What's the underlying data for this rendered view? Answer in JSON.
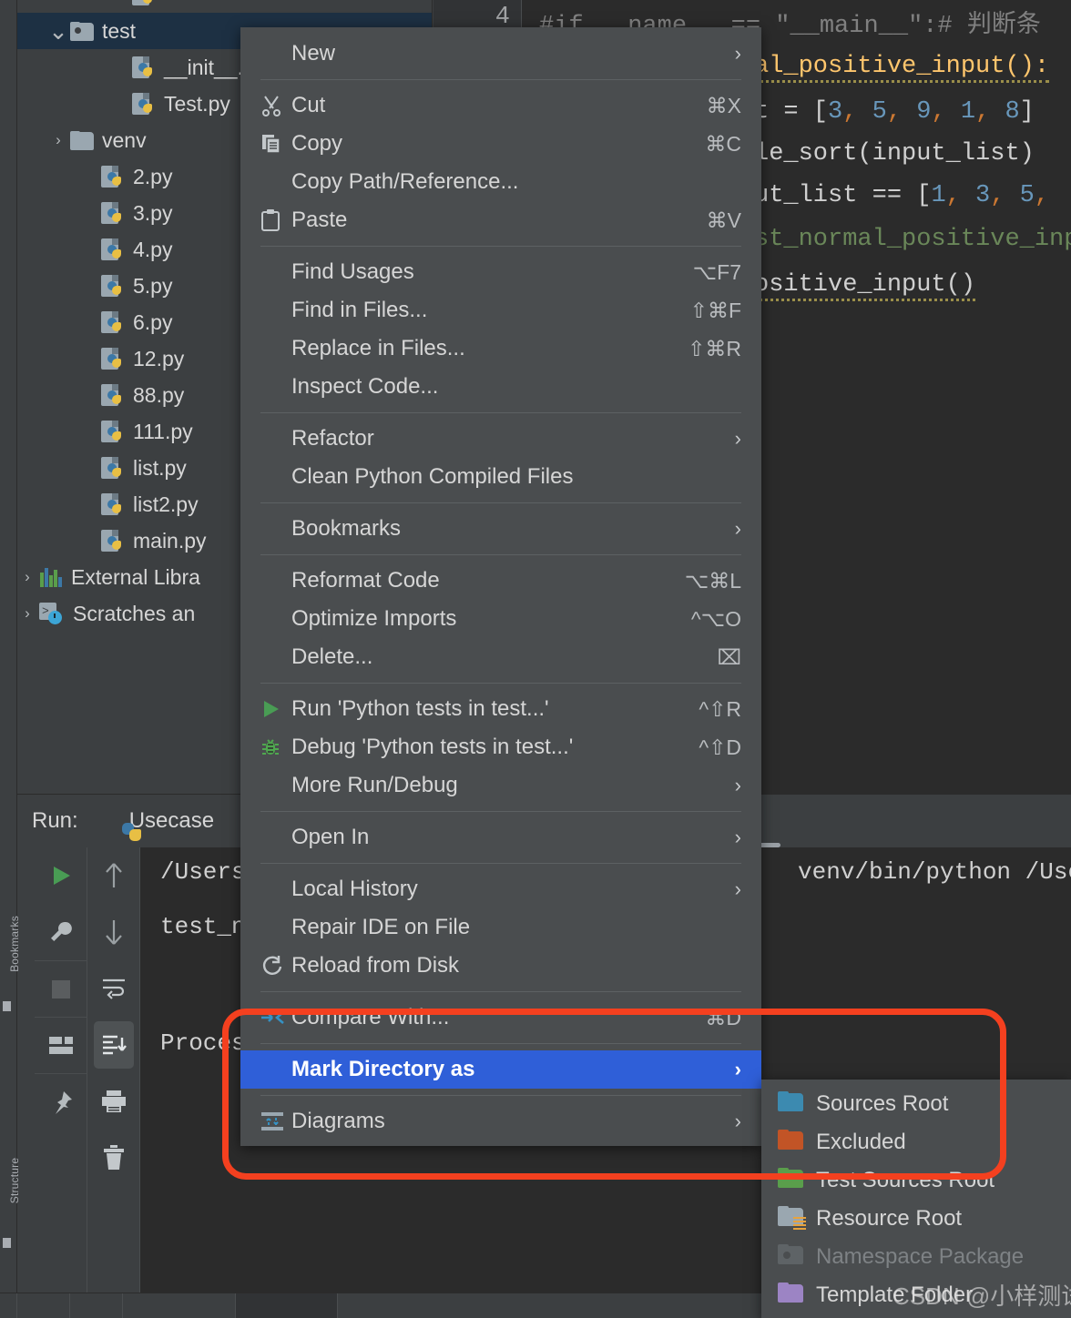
{
  "project_tree": {
    "rows": [
      {
        "label": "",
        "indent": 3,
        "icon": "python-file-icon",
        "partial": true,
        "arrow": "none",
        "selected": false
      },
      {
        "label": "test",
        "indent": 1,
        "icon": "package-folder-icon",
        "arrow": "down",
        "selected": true
      },
      {
        "label": "__init__.py",
        "indent": 3,
        "icon": "python-file-icon",
        "arrow": "none",
        "selected": false
      },
      {
        "label": "Test.py",
        "indent": 3,
        "icon": "python-file-icon",
        "arrow": "none",
        "selected": false
      },
      {
        "label": "venv",
        "indent": 1,
        "icon": "folder-icon",
        "arrow": "right",
        "selected": false
      },
      {
        "label": "2.py",
        "indent": 2,
        "icon": "python-file-icon",
        "arrow": "none",
        "selected": false
      },
      {
        "label": "3.py",
        "indent": 2,
        "icon": "python-file-icon",
        "arrow": "none",
        "selected": false
      },
      {
        "label": "4.py",
        "indent": 2,
        "icon": "python-file-icon",
        "arrow": "none",
        "selected": false
      },
      {
        "label": "5.py",
        "indent": 2,
        "icon": "python-file-icon",
        "arrow": "none",
        "selected": false
      },
      {
        "label": "6.py",
        "indent": 2,
        "icon": "python-file-icon",
        "arrow": "none",
        "selected": false
      },
      {
        "label": "12.py",
        "indent": 2,
        "icon": "python-file-icon",
        "arrow": "none",
        "selected": false
      },
      {
        "label": "88.py",
        "indent": 2,
        "icon": "python-file-icon",
        "arrow": "none",
        "selected": false
      },
      {
        "label": "111.py",
        "indent": 2,
        "icon": "python-file-icon",
        "arrow": "none",
        "selected": false
      },
      {
        "label": "list.py",
        "indent": 2,
        "icon": "python-file-icon",
        "arrow": "none",
        "selected": false
      },
      {
        "label": "list2.py",
        "indent": 2,
        "icon": "python-file-icon",
        "arrow": "none",
        "selected": false
      },
      {
        "label": "main.py",
        "indent": 2,
        "icon": "python-file-icon",
        "arrow": "none",
        "selected": false
      },
      {
        "label": "External Libra",
        "indent": 0,
        "icon": "external-libraries-icon",
        "arrow": "right",
        "selected": false
      },
      {
        "label": "Scratches an",
        "indent": 0,
        "icon": "scratches-icon",
        "arrow": "right",
        "selected": false
      }
    ]
  },
  "tool_window_tabs": {
    "bookmarks": "Bookmarks",
    "structure": "Structure"
  },
  "editor": {
    "gutter_line_number": "4",
    "lines": [
      "#if __name__ == \"__main__\":# 判断条",
      "al_positive_input():",
      "t = [3, 5, 9, 1, 8]",
      "le_sort(input_list)",
      "ut_list == [1, 3, 5,",
      "st_normal_positive_inp",
      "ositive_input()"
    ]
  },
  "run_panel": {
    "label": "Run:",
    "tab_name": "Usecase",
    "tab_icon": "python-icon",
    "console_lines": [
      "/Users/",
      "venv/bin/python /Users",
      "test_n",
      "Process"
    ],
    "toolbar_left": [
      {
        "name": "rerun-button",
        "icon": "play-icon"
      },
      {
        "name": "edit-configurations-button",
        "icon": "wrench-icon"
      },
      {
        "name": "stop-button",
        "icon": "stop-square-icon"
      },
      {
        "name": "layout-button",
        "icon": "layout-icon"
      },
      {
        "name": "pin-tab-button",
        "icon": "pin-icon"
      }
    ],
    "toolbar_right": [
      {
        "name": "up-button",
        "icon": "arrow-up-icon"
      },
      {
        "name": "down-button",
        "icon": "arrow-down-icon"
      },
      {
        "name": "soft-wrap-button",
        "icon": "wrap-icon"
      },
      {
        "name": "scroll-to-end-button",
        "icon": "scroll-end-icon",
        "active": true
      },
      {
        "name": "print-button",
        "icon": "printer-icon"
      },
      {
        "name": "clear-all-button",
        "icon": "trash-icon"
      }
    ]
  },
  "context_menu": {
    "items": [
      {
        "label": "New",
        "shortcut": "",
        "icon": "",
        "submenu": true,
        "sep_after": true
      },
      {
        "label": "Cut",
        "shortcut": "⌘X",
        "icon": "scissors-icon",
        "submenu": false
      },
      {
        "label": "Copy",
        "shortcut": "⌘C",
        "icon": "copy-icon",
        "submenu": false
      },
      {
        "label": "Copy Path/Reference...",
        "shortcut": "",
        "icon": "",
        "submenu": false
      },
      {
        "label": "Paste",
        "shortcut": "⌘V",
        "icon": "clipboard-icon",
        "submenu": false,
        "sep_after": true
      },
      {
        "label": "Find Usages",
        "shortcut": "⌥F7",
        "icon": "",
        "submenu": false
      },
      {
        "label": "Find in Files...",
        "shortcut": "⇧⌘F",
        "icon": "",
        "submenu": false
      },
      {
        "label": "Replace in Files...",
        "shortcut": "⇧⌘R",
        "icon": "",
        "submenu": false
      },
      {
        "label": "Inspect Code...",
        "shortcut": "",
        "icon": "",
        "submenu": false,
        "sep_after": true
      },
      {
        "label": "Refactor",
        "shortcut": "",
        "icon": "",
        "submenu": true
      },
      {
        "label": "Clean Python Compiled Files",
        "shortcut": "",
        "icon": "",
        "submenu": false,
        "sep_after": true
      },
      {
        "label": "Bookmarks",
        "shortcut": "",
        "icon": "",
        "submenu": true,
        "sep_after": true
      },
      {
        "label": "Reformat Code",
        "shortcut": "⌥⌘L",
        "icon": "",
        "submenu": false
      },
      {
        "label": "Optimize Imports",
        "shortcut": "^⌥O",
        "icon": "",
        "submenu": false
      },
      {
        "label": "Delete...",
        "shortcut": "⌧",
        "icon": "",
        "submenu": false,
        "sep_after": true
      },
      {
        "label": "Run 'Python tests in test...'",
        "shortcut": "^⇧R",
        "icon": "run-play-icon",
        "submenu": false
      },
      {
        "label": "Debug 'Python tests in test...'",
        "shortcut": "^⇧D",
        "icon": "debug-bug-icon",
        "submenu": false
      },
      {
        "label": "More Run/Debug",
        "shortcut": "",
        "icon": "",
        "submenu": true,
        "sep_after": true
      },
      {
        "label": "Open In",
        "shortcut": "",
        "icon": "",
        "submenu": true,
        "sep_after": true
      },
      {
        "label": "Local History",
        "shortcut": "",
        "icon": "",
        "submenu": true
      },
      {
        "label": "Repair IDE on File",
        "shortcut": "",
        "icon": "",
        "submenu": false
      },
      {
        "label": "Reload from Disk",
        "shortcut": "",
        "icon": "reload-icon",
        "submenu": false,
        "sep_after": true
      },
      {
        "label": "Compare With...",
        "shortcut": "⌘D",
        "icon": "compare-icon",
        "submenu": false,
        "sep_after": true
      },
      {
        "label": "Mark Directory as",
        "shortcut": "",
        "icon": "",
        "submenu": true,
        "selected": true,
        "sep_after": true
      },
      {
        "label": "Diagrams",
        "shortcut": "",
        "icon": "diagram-icon",
        "submenu": true
      }
    ]
  },
  "submenu": {
    "items": [
      {
        "label": "Sources Root",
        "icon": "folder-icon",
        "color": "#3c8ab0",
        "disabled": false
      },
      {
        "label": "Excluded",
        "icon": "folder-icon",
        "color": "#c25426",
        "disabled": false
      },
      {
        "label": "Test Sources Root",
        "icon": "folder-icon",
        "color": "#5a9e4b",
        "disabled": false
      },
      {
        "label": "Resource Root",
        "icon": "folder-resource-icon",
        "color": "#9aa7b0",
        "disabled": false
      },
      {
        "label": "Namespace Package",
        "icon": "folder-namespace-icon",
        "color": "#5e6366",
        "disabled": true
      },
      {
        "label": "Template Folder",
        "icon": "folder-icon",
        "color": "#9c84c4",
        "disabled": false
      }
    ]
  },
  "annotation": {
    "color": "#f4401f",
    "shape": "rounded-rectangle"
  },
  "watermark": {
    "text": "CSDN @小样测试笔记"
  },
  "colors": {
    "panel_bg": "#3c3f41",
    "editor_bg": "#2b2b2b",
    "menu_bg": "#4a4d4f",
    "selection_blue": "#2f5fd8",
    "tree_selection": "#1d3043",
    "annotation_red": "#f4401f"
  }
}
